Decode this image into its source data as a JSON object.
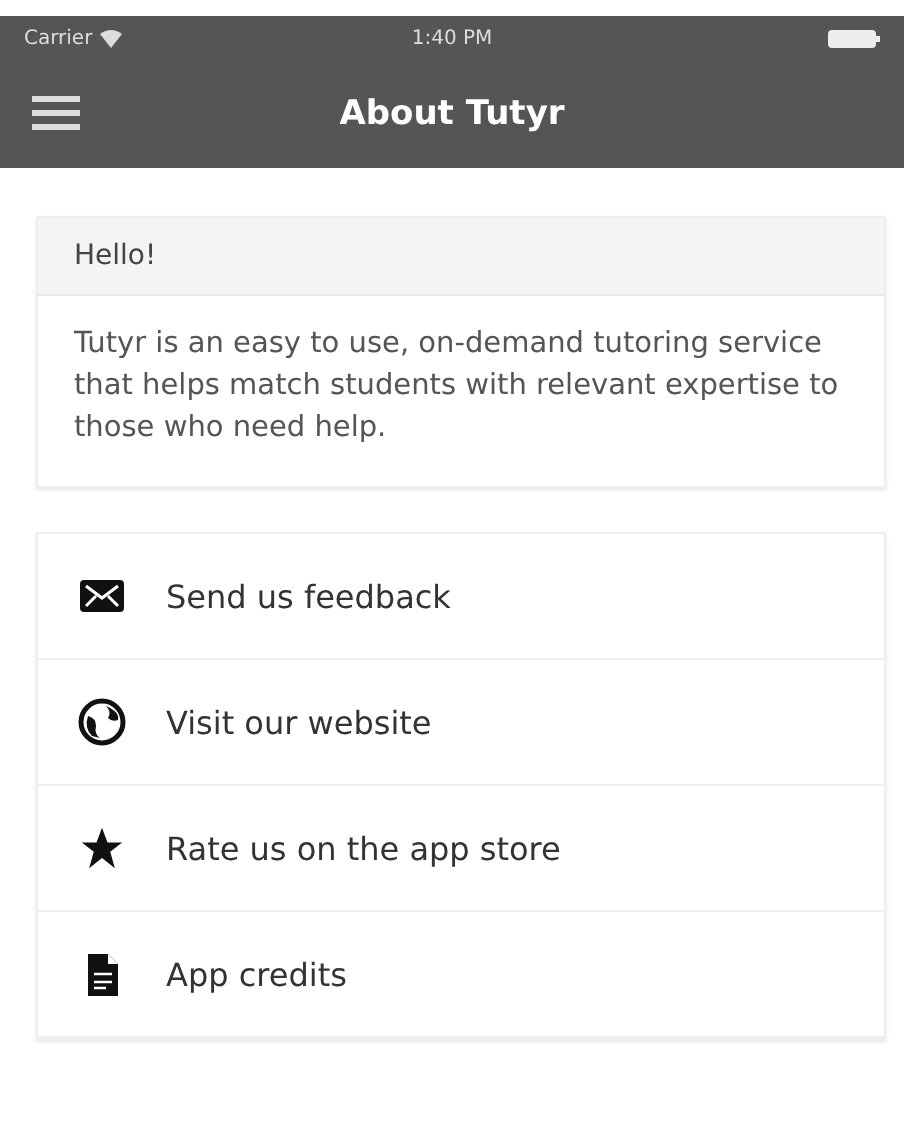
{
  "status_bar": {
    "carrier": "Carrier",
    "time": "1:40 PM"
  },
  "nav_bar": {
    "title": "About Tutyr"
  },
  "intro_card": {
    "heading": "Hello!",
    "body": "Tutyr is an easy to use, on-demand tutoring service that helps match students with relevant expertise to those who need help."
  },
  "menu": [
    {
      "kind": "envelope",
      "label": "Send us feedback"
    },
    {
      "kind": "globe",
      "label": "Visit our website"
    },
    {
      "kind": "star",
      "label": "Rate us on the app store"
    },
    {
      "kind": "document",
      "label": "App credits"
    }
  ]
}
